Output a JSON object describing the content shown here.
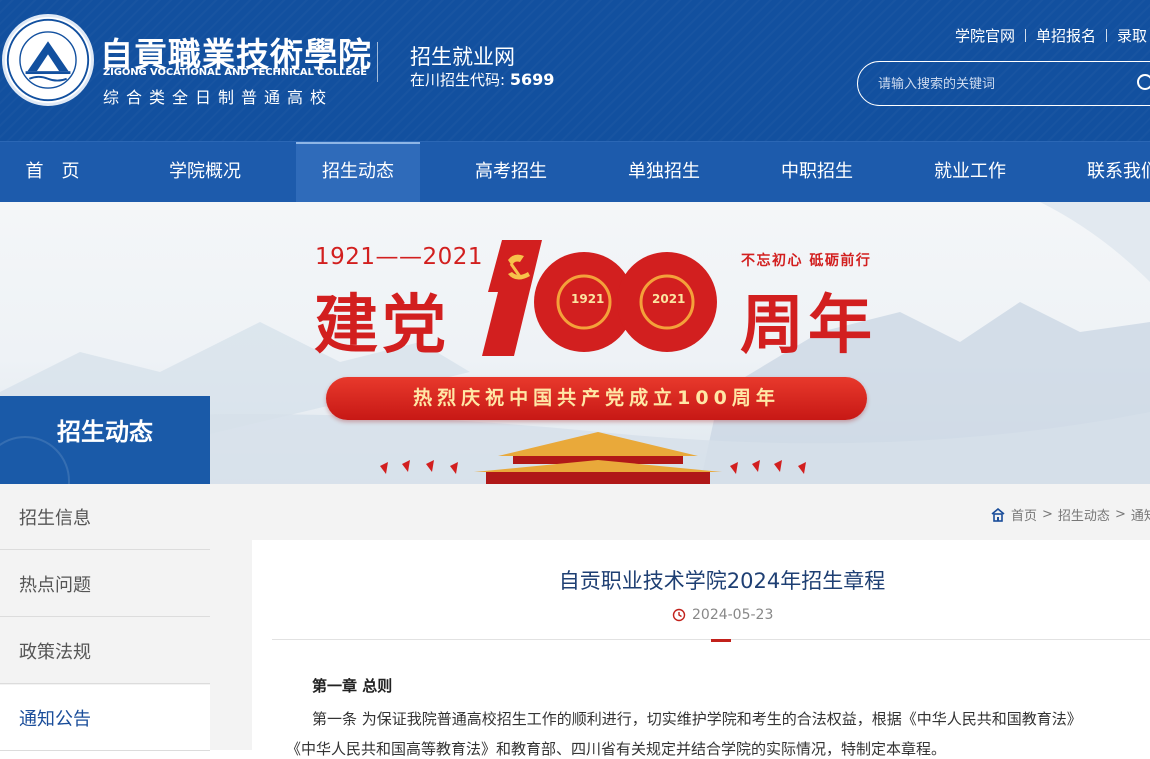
{
  "header": {
    "college_name_cn": "自貢職業技術學院",
    "college_name_en": "ZIGONG VOCATIONAL AND TECHNICAL COLLEGE",
    "college_type": "综合类全日制普通高校",
    "site_name": "招生就业网",
    "enrollment_code_label": "在川招生代码: ",
    "enrollment_code": "5699",
    "top_links": [
      "学院官网",
      "单招报名",
      "录取"
    ],
    "search_placeholder": "请输入搜索的关键词"
  },
  "nav": {
    "items": [
      "首　页",
      "学院概况",
      "招生动态",
      "高考招生",
      "单独招生",
      "中职招生",
      "就业工作",
      "联系我们"
    ],
    "active_index": 2
  },
  "banner": {
    "year_range": "1921——2021",
    "title_left": "建党",
    "title_right": "周年",
    "slogan": "不忘初心 砥砺前行",
    "year_a": "1921",
    "year_b": "2021",
    "ribbon_text": "热烈庆祝中国共产党成立100周年",
    "colors": {
      "red": "#d21f1f",
      "gold": "#ffe7a6"
    }
  },
  "sidebar": {
    "title": "招生动态",
    "items": [
      "招生信息",
      "热点问题",
      "政策法规",
      "通知公告"
    ],
    "active_index": 3
  },
  "breadcrumb": {
    "items": [
      "首页",
      "招生动态",
      "通知"
    ]
  },
  "article": {
    "title": "自贡职业技术学院2024年招生章程",
    "date": "2024-05-23",
    "chapter": "第一章 总则",
    "paragraph1": "第一条 为保证我院普通高校招生工作的顺利进行，切实维护学院和考生的合法权益，根据《中华人民共和国教育法》",
    "paragraph2": "《中华人民共和国高等教育法》和教育部、四川省有关规定并结合学院的实际情况，特制定本章程。"
  },
  "colors": {
    "header_blue": "#12509f",
    "nav_blue": "#1d5bac",
    "accent_red": "#c2211b"
  }
}
